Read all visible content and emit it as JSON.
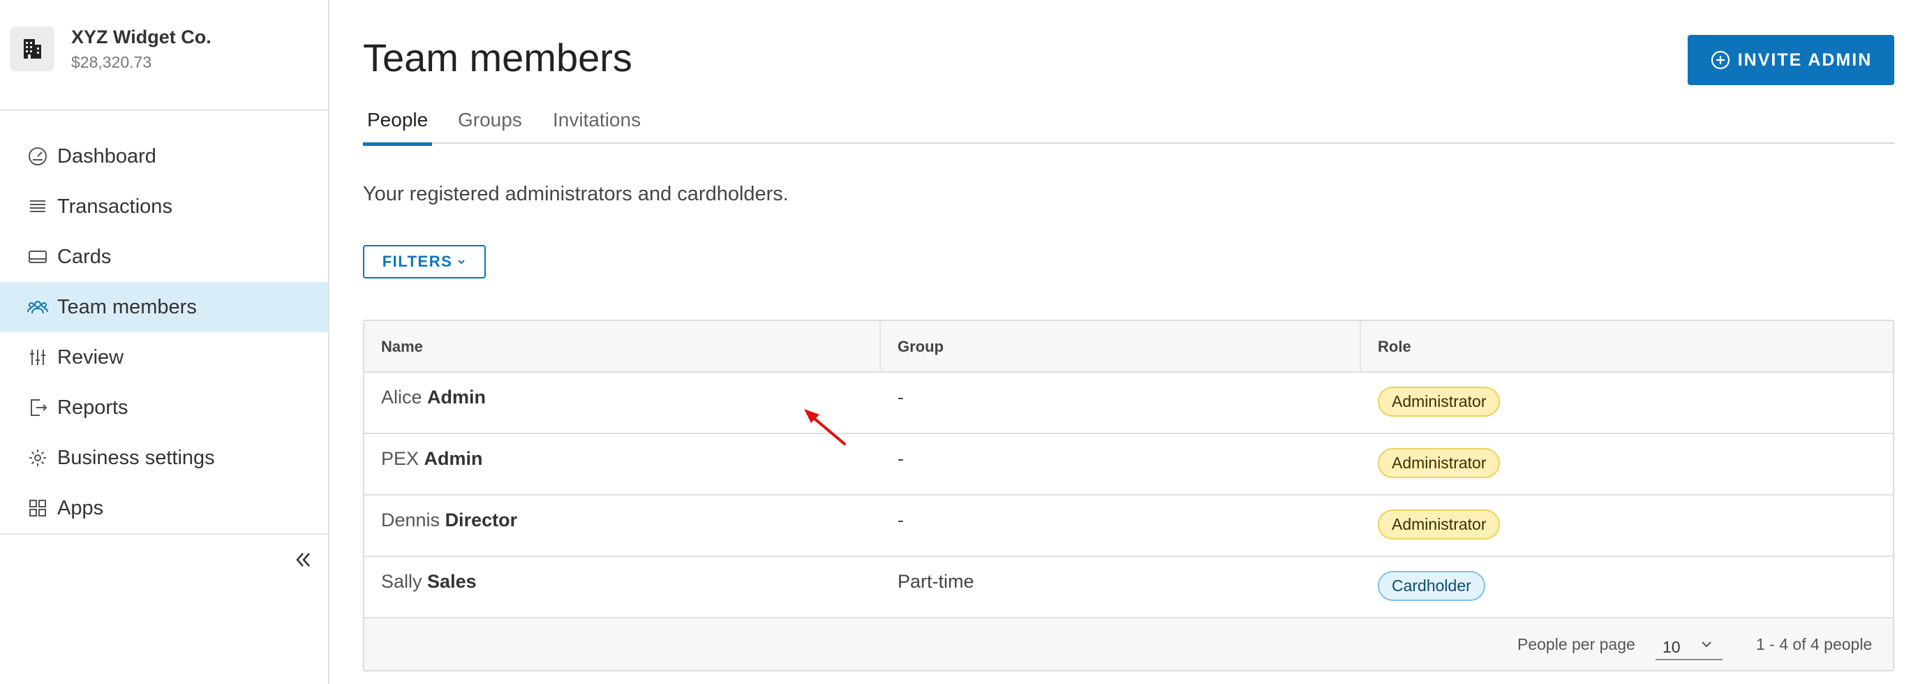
{
  "company": {
    "name": "XYZ Widget Co.",
    "balance": "$28,320.73",
    "logo_icon": "building-icon"
  },
  "sidebar": {
    "items": [
      {
        "label": "Dashboard",
        "icon": "gauge-icon",
        "active": false
      },
      {
        "label": "Transactions",
        "icon": "list-icon",
        "active": false
      },
      {
        "label": "Cards",
        "icon": "card-icon",
        "active": false
      },
      {
        "label": "Team members",
        "icon": "team-icon",
        "active": true
      },
      {
        "label": "Review",
        "icon": "sliders-icon",
        "active": false
      },
      {
        "label": "Reports",
        "icon": "export-icon",
        "active": false
      },
      {
        "label": "Business settings",
        "icon": "gear-icon",
        "active": false
      },
      {
        "label": "Apps",
        "icon": "grid-icon",
        "active": false
      }
    ],
    "collapse_icon": "double-chevron-left-icon"
  },
  "header": {
    "title": "Team members",
    "invite_label": "INVITE ADMIN"
  },
  "tabs": [
    {
      "label": "People",
      "active": true
    },
    {
      "label": "Groups",
      "active": false
    },
    {
      "label": "Invitations",
      "active": false
    }
  ],
  "description": "Your registered administrators and cardholders.",
  "filters_label": "FILTERS",
  "table": {
    "columns": [
      "Name",
      "Group",
      "Role"
    ],
    "rows": [
      {
        "first": "Alice",
        "last": "Admin",
        "group": "-",
        "role": "Administrator"
      },
      {
        "first": "PEX",
        "last": "Admin",
        "group": "-",
        "role": "Administrator"
      },
      {
        "first": "Dennis",
        "last": "Director",
        "group": "-",
        "role": "Administrator"
      },
      {
        "first": "Sally",
        "last": "Sales",
        "group": "Part-time",
        "role": "Cardholder"
      }
    ],
    "footer": {
      "per_page_label": "People per page",
      "per_page_value": "10",
      "range": "1 - 4 of 4 people"
    }
  },
  "colors": {
    "accent": "#0d74bb",
    "active_nav_bg": "#d9edf8",
    "admin_badge": "#fdf1b8",
    "cardholder_badge": "#e3f3fb",
    "annotation_arrow": "#e01010"
  }
}
